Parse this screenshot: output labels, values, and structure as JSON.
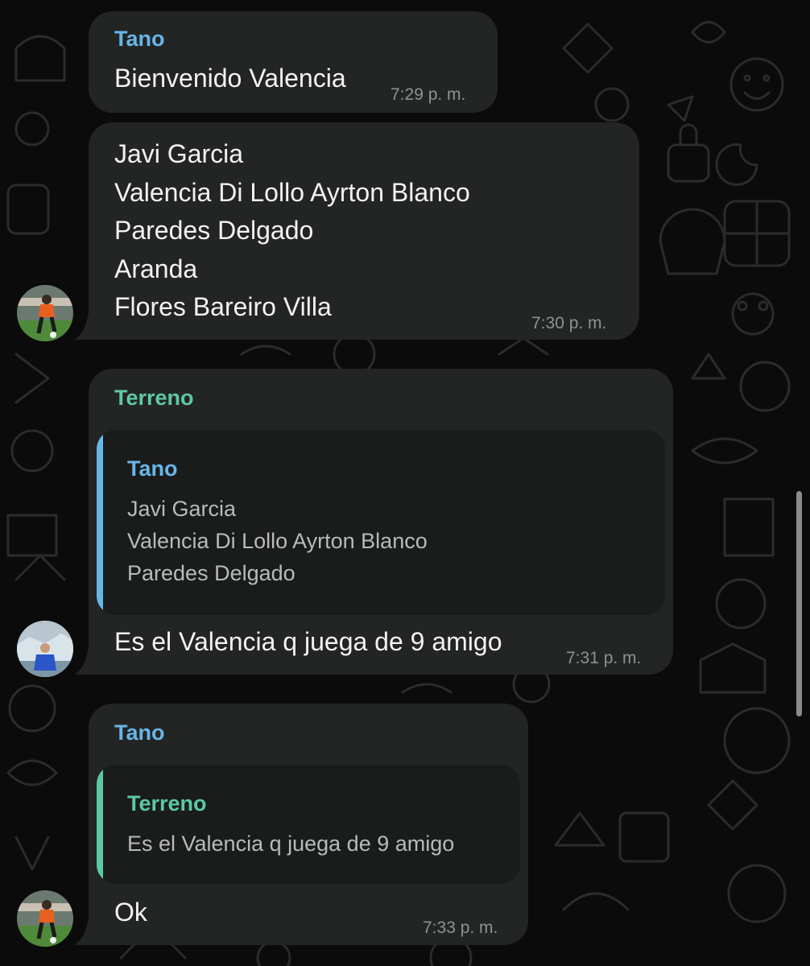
{
  "colors": {
    "background": "#0b0b0b",
    "bubble": "#232424",
    "quote_background": "#1a1b1b",
    "tano": "#67b6e8",
    "terreno": "#5cc8a6",
    "time": "#8f9293"
  },
  "messages": [
    {
      "sender": "Tano",
      "text": "Bienvenido Valencia",
      "time": "7:29 p. m."
    },
    {
      "text": "Javi Garcia\nValencia Di Lollo Ayrton Blanco\nParedes Delgado\nAranda\nFlores Bareiro Villa",
      "time": "7:30 p. m.",
      "avatar": "avatar-tano"
    },
    {
      "sender": "Terreno",
      "quote": {
        "sender": "Tano",
        "text": "Javi Garcia\nValencia Di Lollo Ayrton Blanco\nParedes Delgado"
      },
      "text": "Es el Valencia q juega de 9 amigo",
      "time": "7:31 p. m.",
      "avatar": "avatar-terreno"
    },
    {
      "sender": "Tano",
      "quote": {
        "sender": "Terreno",
        "text": "Es el Valencia q juega de 9 amigo"
      },
      "text": "Ok",
      "time": "7:33 p. m.",
      "avatar": "avatar-tano"
    }
  ]
}
